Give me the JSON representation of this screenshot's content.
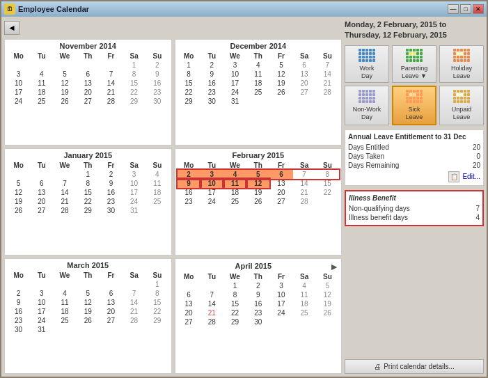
{
  "window": {
    "title": "Employee Calendar",
    "icon": "🗓"
  },
  "title_buttons": {
    "minimize": "—",
    "maximize": "□",
    "close": "✕"
  },
  "date_range": {
    "line1": "Monday, 2 February, 2015 to",
    "line2": "Thursday, 12 February, 2015"
  },
  "leave_types": [
    {
      "id": "work-day",
      "label": "Work\nDay",
      "color": "#4488cc",
      "selected": false
    },
    {
      "id": "parenting-leave",
      "label": "Parenting\nLeave ▼",
      "color": "#44aa44",
      "selected": false
    },
    {
      "id": "holiday-leave",
      "label": "Holiday\nLeave",
      "color": "#ee8844",
      "selected": false
    },
    {
      "id": "non-work-day",
      "label": "Non-Work\nDay",
      "color": "#8888cc",
      "selected": false
    },
    {
      "id": "sick-leave",
      "label": "Sick\nLeave",
      "color": "#ff9955",
      "selected": true
    },
    {
      "id": "unpaid-leave",
      "label": "Unpaid\nLeave",
      "color": "#ddaa44",
      "selected": false
    }
  ],
  "entitlement": {
    "title": "Annual Leave Entitlement to 31 Dec",
    "rows": [
      {
        "label": "Days Entitled",
        "value": "20"
      },
      {
        "label": "Days Taken",
        "value": "0"
      },
      {
        "label": "Days Remaining",
        "value": "20"
      }
    ],
    "edit_label": "Edit..."
  },
  "illness": {
    "title": "Illness Benefit",
    "rows": [
      {
        "label": "Non-qualifying days",
        "value": "7"
      },
      {
        "label": "Illness benefit days",
        "value": "4"
      }
    ]
  },
  "print_button": "Print calendar details...",
  "calendars": [
    {
      "id": "nov2014",
      "title": "November 2014",
      "headers": [
        "Mo",
        "Tu",
        "We",
        "Th",
        "Fr",
        "Sa",
        "Su"
      ],
      "weeks": [
        [
          "",
          "",
          "",
          "",
          "",
          "1",
          "2"
        ],
        [
          "3",
          "4",
          "5",
          "6",
          "7",
          "8",
          "9"
        ],
        [
          "10",
          "11",
          "12",
          "13",
          "14",
          "15",
          "16"
        ],
        [
          "17",
          "18",
          "19",
          "20",
          "21",
          "22",
          "23"
        ],
        [
          "24",
          "25",
          "26",
          "27",
          "28",
          "29",
          "30"
        ]
      ]
    },
    {
      "id": "dec2014",
      "title": "December 2014",
      "headers": [
        "Mo",
        "Tu",
        "We",
        "Th",
        "Fr",
        "Sa",
        "Su"
      ],
      "weeks": [
        [
          "1",
          "2",
          "3",
          "4",
          "5",
          "6",
          "7"
        ],
        [
          "8",
          "9",
          "10",
          "11",
          "12",
          "13",
          "14"
        ],
        [
          "15",
          "16",
          "17",
          "18",
          "19",
          "20",
          "21"
        ],
        [
          "22",
          "23",
          "24",
          "25",
          "26",
          "27",
          "28"
        ],
        [
          "29",
          "30",
          "31",
          "",
          "",
          "",
          ""
        ]
      ]
    },
    {
      "id": "jan2015",
      "title": "January 2015",
      "headers": [
        "Mo",
        "Tu",
        "We",
        "Th",
        "Fr",
        "Sa",
        "Su"
      ],
      "weeks": [
        [
          "",
          "",
          "",
          "1",
          "2",
          "3",
          "4"
        ],
        [
          "5",
          "6",
          "7",
          "8",
          "9",
          "10",
          "11"
        ],
        [
          "12",
          "13",
          "14",
          "15",
          "16",
          "17",
          "18"
        ],
        [
          "19",
          "20",
          "21",
          "22",
          "23",
          "24",
          "25"
        ],
        [
          "26",
          "27",
          "28",
          "29",
          "30",
          "31",
          ""
        ]
      ]
    },
    {
      "id": "feb2015",
      "title": "February 2015",
      "headers": [
        "Mo",
        "Tu",
        "We",
        "Th",
        "Fr",
        "Sa",
        "Su"
      ],
      "weeks": [
        [
          "2",
          "3",
          "4",
          "5",
          "6",
          "7",
          "8"
        ],
        [
          "9",
          "10",
          "11",
          "12",
          "13",
          "14",
          "15"
        ],
        [
          "16",
          "17",
          "18",
          "19",
          "20",
          "21",
          "22"
        ],
        [
          "23",
          "24",
          "25",
          "26",
          "27",
          "28",
          ""
        ]
      ]
    },
    {
      "id": "mar2015",
      "title": "March 2015",
      "headers": [
        "Mo",
        "Tu",
        "We",
        "Th",
        "Fr",
        "Sa",
        "Su"
      ],
      "weeks": [
        [
          "",
          "",
          "",
          "",
          "",
          "",
          "1"
        ],
        [
          "2",
          "3",
          "4",
          "5",
          "6",
          "7",
          "8"
        ],
        [
          "9",
          "10",
          "11",
          "12",
          "13",
          "14",
          "15"
        ],
        [
          "16",
          "17",
          "18",
          "19",
          "20",
          "21",
          "22"
        ],
        [
          "23",
          "24",
          "25",
          "26",
          "27",
          "28",
          "29"
        ],
        [
          "30",
          "31",
          "",
          "",
          "",
          "",
          ""
        ]
      ]
    },
    {
      "id": "apr2015",
      "title": "April 2015",
      "headers": [
        "Mo",
        "Tu",
        "We",
        "Th",
        "Fr",
        "Sa",
        "Su"
      ],
      "weeks": [
        [
          "",
          "",
          "1",
          "2",
          "3",
          "4",
          "5"
        ],
        [
          "6",
          "7",
          "8",
          "9",
          "10",
          "11",
          "12"
        ],
        [
          "13",
          "14",
          "15",
          "16",
          "17",
          "18",
          "19"
        ],
        [
          "20",
          "21",
          "22",
          "23",
          "24",
          "25",
          "26"
        ],
        [
          "27",
          "28",
          "29",
          "30",
          "",
          "",
          ""
        ]
      ]
    }
  ]
}
